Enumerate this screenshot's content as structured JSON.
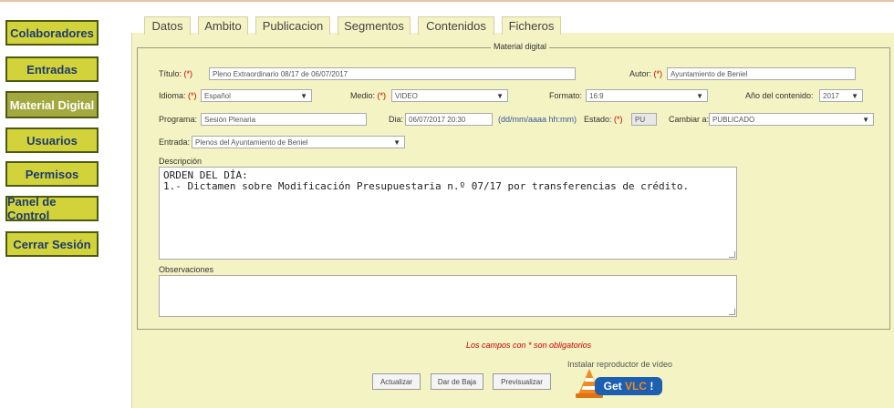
{
  "sidebar": {
    "items": [
      {
        "label": "Colaboradores"
      },
      {
        "label": "Entradas"
      },
      {
        "label": "Material Digital"
      },
      {
        "label": "Usuarios"
      },
      {
        "label": "Permisos"
      },
      {
        "label": "Panel de Control"
      },
      {
        "label": "Cerrar Sesión"
      }
    ],
    "active_index": 2
  },
  "tabs": [
    {
      "label": "Datos"
    },
    {
      "label": "Ambito"
    },
    {
      "label": "Publicacion"
    },
    {
      "label": "Segmentos"
    },
    {
      "label": "Contenidos"
    },
    {
      "label": "Ficheros"
    }
  ],
  "form": {
    "legend": "Material digital",
    "required_mark": "(*)",
    "titulo": {
      "label": "Título:",
      "value": "Pleno Extraordinario 08/17 de 06/07/2017"
    },
    "autor": {
      "label": "Autor:",
      "value": "Ayuntamiento de Beniel"
    },
    "idioma": {
      "label": "Idioma:",
      "value": "Español"
    },
    "medio": {
      "label": "Medio:",
      "value": "VIDEO"
    },
    "formato": {
      "label": "Formato:",
      "value": "16:9"
    },
    "anio": {
      "label": "Año del contenido:",
      "value": "2017"
    },
    "programa": {
      "label": "Programa:",
      "value": "Sesión Plenaria"
    },
    "dia": {
      "label": "Dia:",
      "value": "06/07/2017 20:30",
      "hint": "(dd/mm/aaaa hh:mm)"
    },
    "estado": {
      "label": "Estado:",
      "value": "PU"
    },
    "cambiar": {
      "label": "Cambiar a:",
      "value": "PUBLICADO"
    },
    "entrada": {
      "label": "Entrada:",
      "value": "Plenos del Ayuntamiento de Beniel"
    },
    "descripcion": {
      "label": "Descripción",
      "value": "ORDEN DEL DÍA:\n1.- Dictamen sobre Modificación Presupuestaria n.º 07/17 por transferencias de crédito."
    },
    "observaciones": {
      "label": "Observaciones",
      "value": ""
    }
  },
  "footer": {
    "required_note": "Los campos con * son obligatorios",
    "vlc_note": "Instalar reproductor de vídeo",
    "btn_actualizar": "Actualizar",
    "btn_baja": "Dar de Baja",
    "btn_previsualizar": "Previsualizar",
    "vlc_get": "Get",
    "vlc_name": "VLC",
    "vlc_bang": "!"
  },
  "colors": {
    "nav_bg": "#d2d23a",
    "nav_active_bg": "#a3a83f",
    "nav_text": "#1c3b70",
    "panel_bg": "#f3f3c4",
    "required": "#cc0000",
    "vlc_blue": "#1d5fb0",
    "vlc_orange": "#f08a1c"
  }
}
